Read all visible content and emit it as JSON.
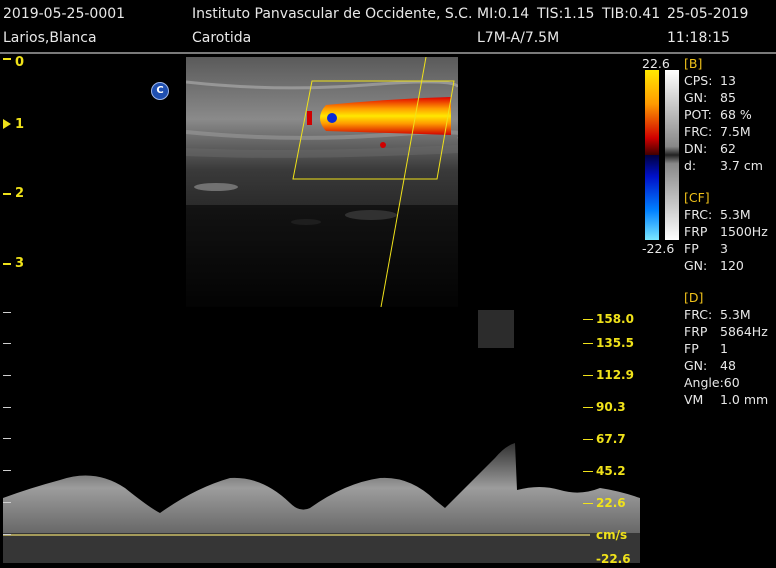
{
  "header": {
    "exam_id": "2019-05-25-0001",
    "patient": "Larios,Blanca",
    "institution": "Instituto Panvascular de Occidente, S.C.",
    "mi": "MI:0.14",
    "tis": "TIS:1.15",
    "tib": "TIB:0.41",
    "date": "25-05-2019",
    "study": "Carotida",
    "probe": "L7M-A/7.5M",
    "time": "11:18:15"
  },
  "depth_scale": [
    "0",
    "1",
    "2",
    "3"
  ],
  "colorbar": {
    "max": "22.6",
    "min": "-22.6"
  },
  "panel_b": {
    "title": "[B]",
    "rows": [
      {
        "k": "CPS:",
        "v": "13"
      },
      {
        "k": "GN:",
        "v": "85"
      },
      {
        "k": "POT:",
        "v": "68 %"
      },
      {
        "k": "FRC:",
        "v": "7.5M"
      },
      {
        "k": "DN:",
        "v": "62"
      },
      {
        "k": "d:",
        "v": "3.7 cm"
      }
    ]
  },
  "panel_cf": {
    "title": "[CF]",
    "rows": [
      {
        "k": "FRC:",
        "v": "5.3M"
      },
      {
        "k": "FRP",
        "v": "1500Hz"
      },
      {
        "k": "FP",
        "v": "3"
      },
      {
        "k": "GN:",
        "v": "120"
      }
    ]
  },
  "panel_d": {
    "title": "[D]",
    "rows": [
      {
        "k": "FRC:",
        "v": "5.3M"
      },
      {
        "k": "FRP",
        "v": "5864Hz"
      },
      {
        "k": "FP",
        "v": "1"
      },
      {
        "k": "GN:",
        "v": "48"
      },
      {
        "k": "Angle:60",
        "v": ""
      },
      {
        "k": "VM",
        "v": "1.0 mm"
      }
    ]
  },
  "velocity_scale": [
    "158.0",
    "135.5",
    "112.9",
    "90.3",
    "67.7",
    "45.2",
    "22.6",
    "cm/s",
    "-22.6"
  ],
  "colors": {
    "accent": "#f0e21a",
    "orange": "#f0c21a",
    "doppler_blue": "#1f4fb0"
  }
}
